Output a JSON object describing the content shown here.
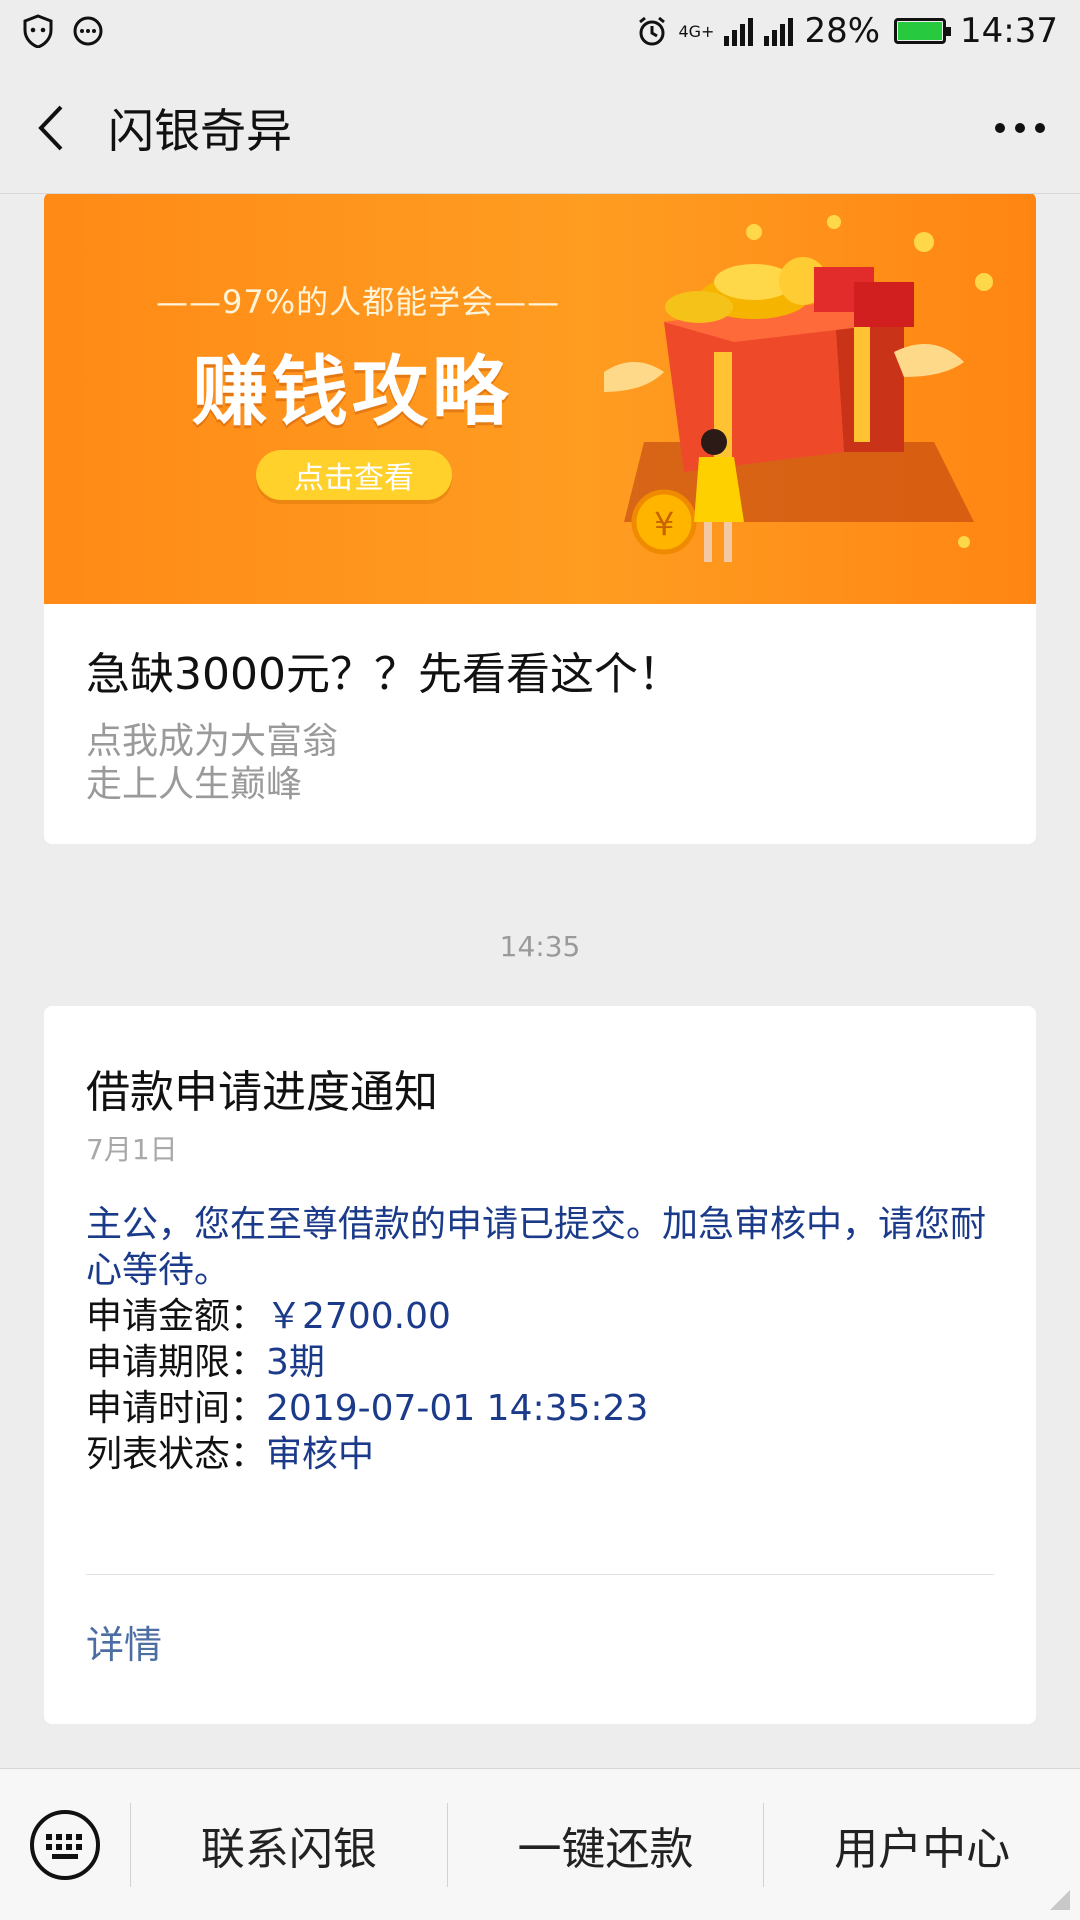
{
  "status_bar": {
    "network": "4G+",
    "battery": "28%",
    "time": "14:37",
    "icons": [
      "shield-icon",
      "chat-bubble-icon",
      "alarm-icon",
      "signal-icon",
      "battery-icon"
    ],
    "battery_color": "#27c93f"
  },
  "nav": {
    "title": "闪银奇异",
    "back_icon": "chevron-left-icon",
    "more_icon": "more-dots-icon"
  },
  "article_card": {
    "banner": {
      "tagline": "——97%的人都能学会——",
      "title": "赚钱攻略",
      "button": "点击查看",
      "background": "#ff9418"
    },
    "title": "急缺3000元？？先看看这个！",
    "desc_line1": "点我成为大富翁",
    "desc_line2": "走上人生巅峰"
  },
  "timestamp": "14:35",
  "notification_card": {
    "title": "借款申请进度通知",
    "date": "7月1日",
    "message": "主公，您在至尊借款的申请已提交。加急审核中，请您耐心等待。",
    "rows": [
      {
        "label": "申请金额：",
        "value": "￥2700.00"
      },
      {
        "label": "申请期限：",
        "value": "3期"
      },
      {
        "label": "申请时间：",
        "value": "2019-07-01 14:35:23"
      },
      {
        "label": "列表状态：",
        "value": "审核中"
      }
    ],
    "link": "详情",
    "accent": "#1b3b8a"
  },
  "bottom_menu": {
    "keyboard_icon": "keyboard-icon",
    "items": [
      "联系闪银",
      "一键还款",
      "用户中心"
    ]
  }
}
